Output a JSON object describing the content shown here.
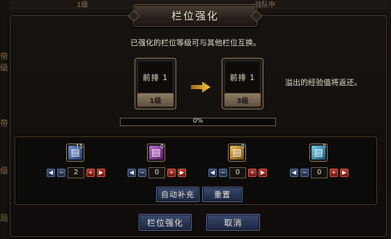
{
  "background": {
    "top_text_1": "1级",
    "top_text_2": "战队中",
    "left_glyphs": [
      "帝",
      "级",
      "帝",
      "级",
      "局"
    ]
  },
  "dialog": {
    "title": "栏位强化",
    "subtitle": "已强化的栏位等级可与其他栏位互换。",
    "source_slot": {
      "name": "前排 1",
      "level": "1级"
    },
    "target_slot": {
      "name": "前排 1",
      "level": "3级"
    },
    "arrow_icon": "right-arrow-icon",
    "return_note": "溢出的经验值将返还。",
    "progress": {
      "value": 0,
      "label": "0%"
    },
    "materials": [
      {
        "icon": "book-blue-icon",
        "color": "#3f6db5",
        "count": "15",
        "quantity": "2"
      },
      {
        "icon": "book-purple-icon",
        "color": "#8d3a9e",
        "count": "0",
        "quantity": "0"
      },
      {
        "icon": "book-gold-icon",
        "color": "#c98a25",
        "count": "0",
        "quantity": "0"
      },
      {
        "icon": "book-cyan-icon",
        "color": "#2f93b8",
        "count": "0",
        "quantity": "0"
      }
    ],
    "auto_fill_label": "自动补充",
    "reset_label": "重置",
    "confirm_label": "栏位强化",
    "cancel_label": "取消"
  },
  "colors": {
    "accent_button": "#2a3a5e",
    "stepper_minus": "#2c3b5c",
    "stepper_plus": "#9a2a20"
  }
}
